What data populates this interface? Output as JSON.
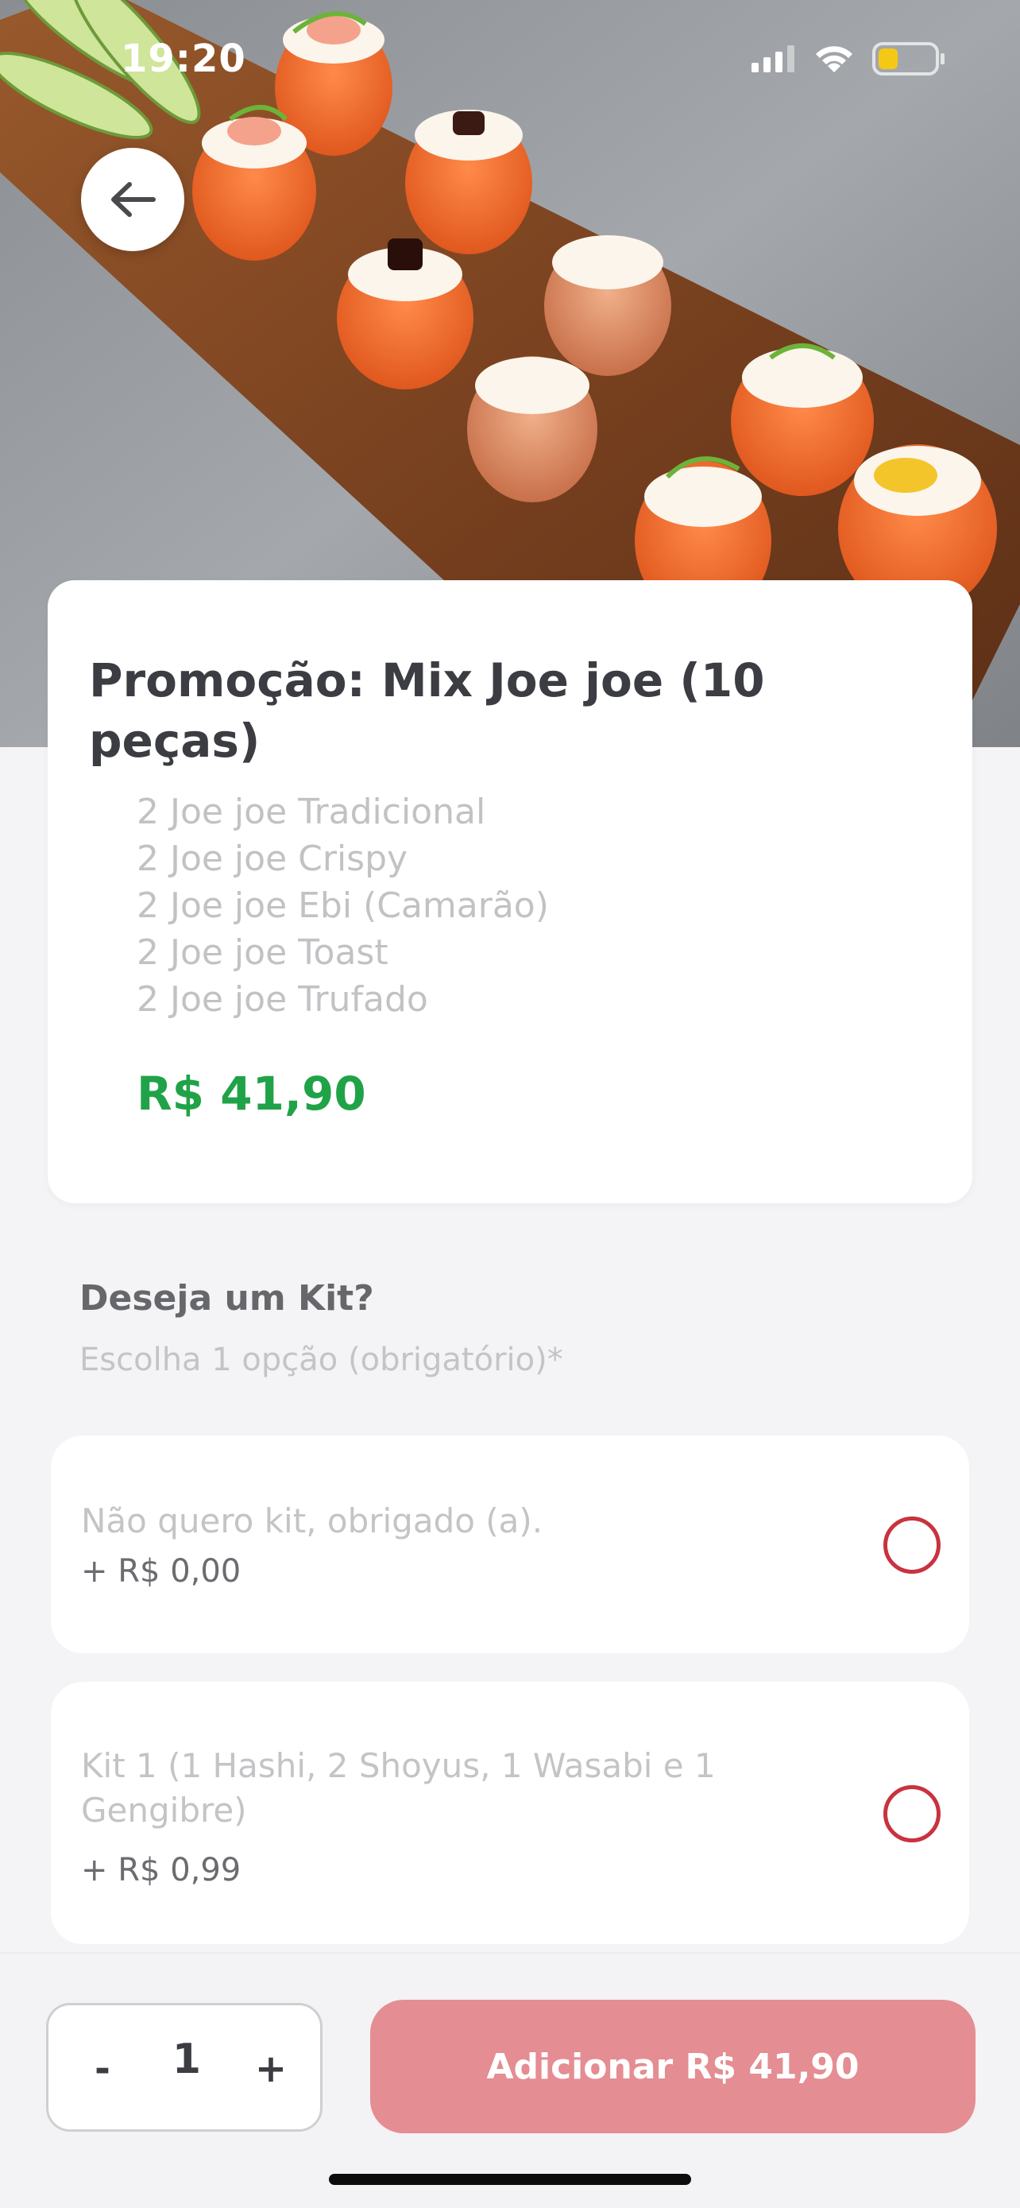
{
  "status_bar": {
    "time": "19:20",
    "icons": [
      "signal-icon",
      "wifi-icon",
      "battery-icon"
    ],
    "battery_color": "#f5c816"
  },
  "hero": {
    "image": "sushi-joe-joe-platter",
    "back_icon": "arrow-left-icon"
  },
  "product": {
    "title": "Promoção: Mix Joe joe (10 peças)",
    "description": [
      "2 Joe joe Tradicional",
      "2 Joe joe Crispy",
      "2 Joe joe Ebi (Camarão)",
      "2 Joe joe Toast",
      "2 Joe joe Trufado"
    ],
    "price": "R$ 41,90"
  },
  "kit_section": {
    "title": "Deseja um Kit?",
    "subtitle": "Escolha 1 opção (obrigatório)*",
    "options": [
      {
        "label": "Não quero kit, obrigado (a).",
        "price": "+ R$ 0,00",
        "selected": false
      },
      {
        "label": "Kit 1 (1 Hashi, 2 Shoyus, 1 Wasabi e 1 Gengibre)",
        "price": "+ R$ 0,99",
        "selected": false
      }
    ]
  },
  "bottom_bar": {
    "minus_label": "-",
    "quantity": "1",
    "plus_label": "+",
    "add_button_label": "Adicionar R$ 41,90"
  },
  "colors": {
    "price_green": "#20a348",
    "accent_red": "#c9323f",
    "add_button": "#e48d92"
  }
}
